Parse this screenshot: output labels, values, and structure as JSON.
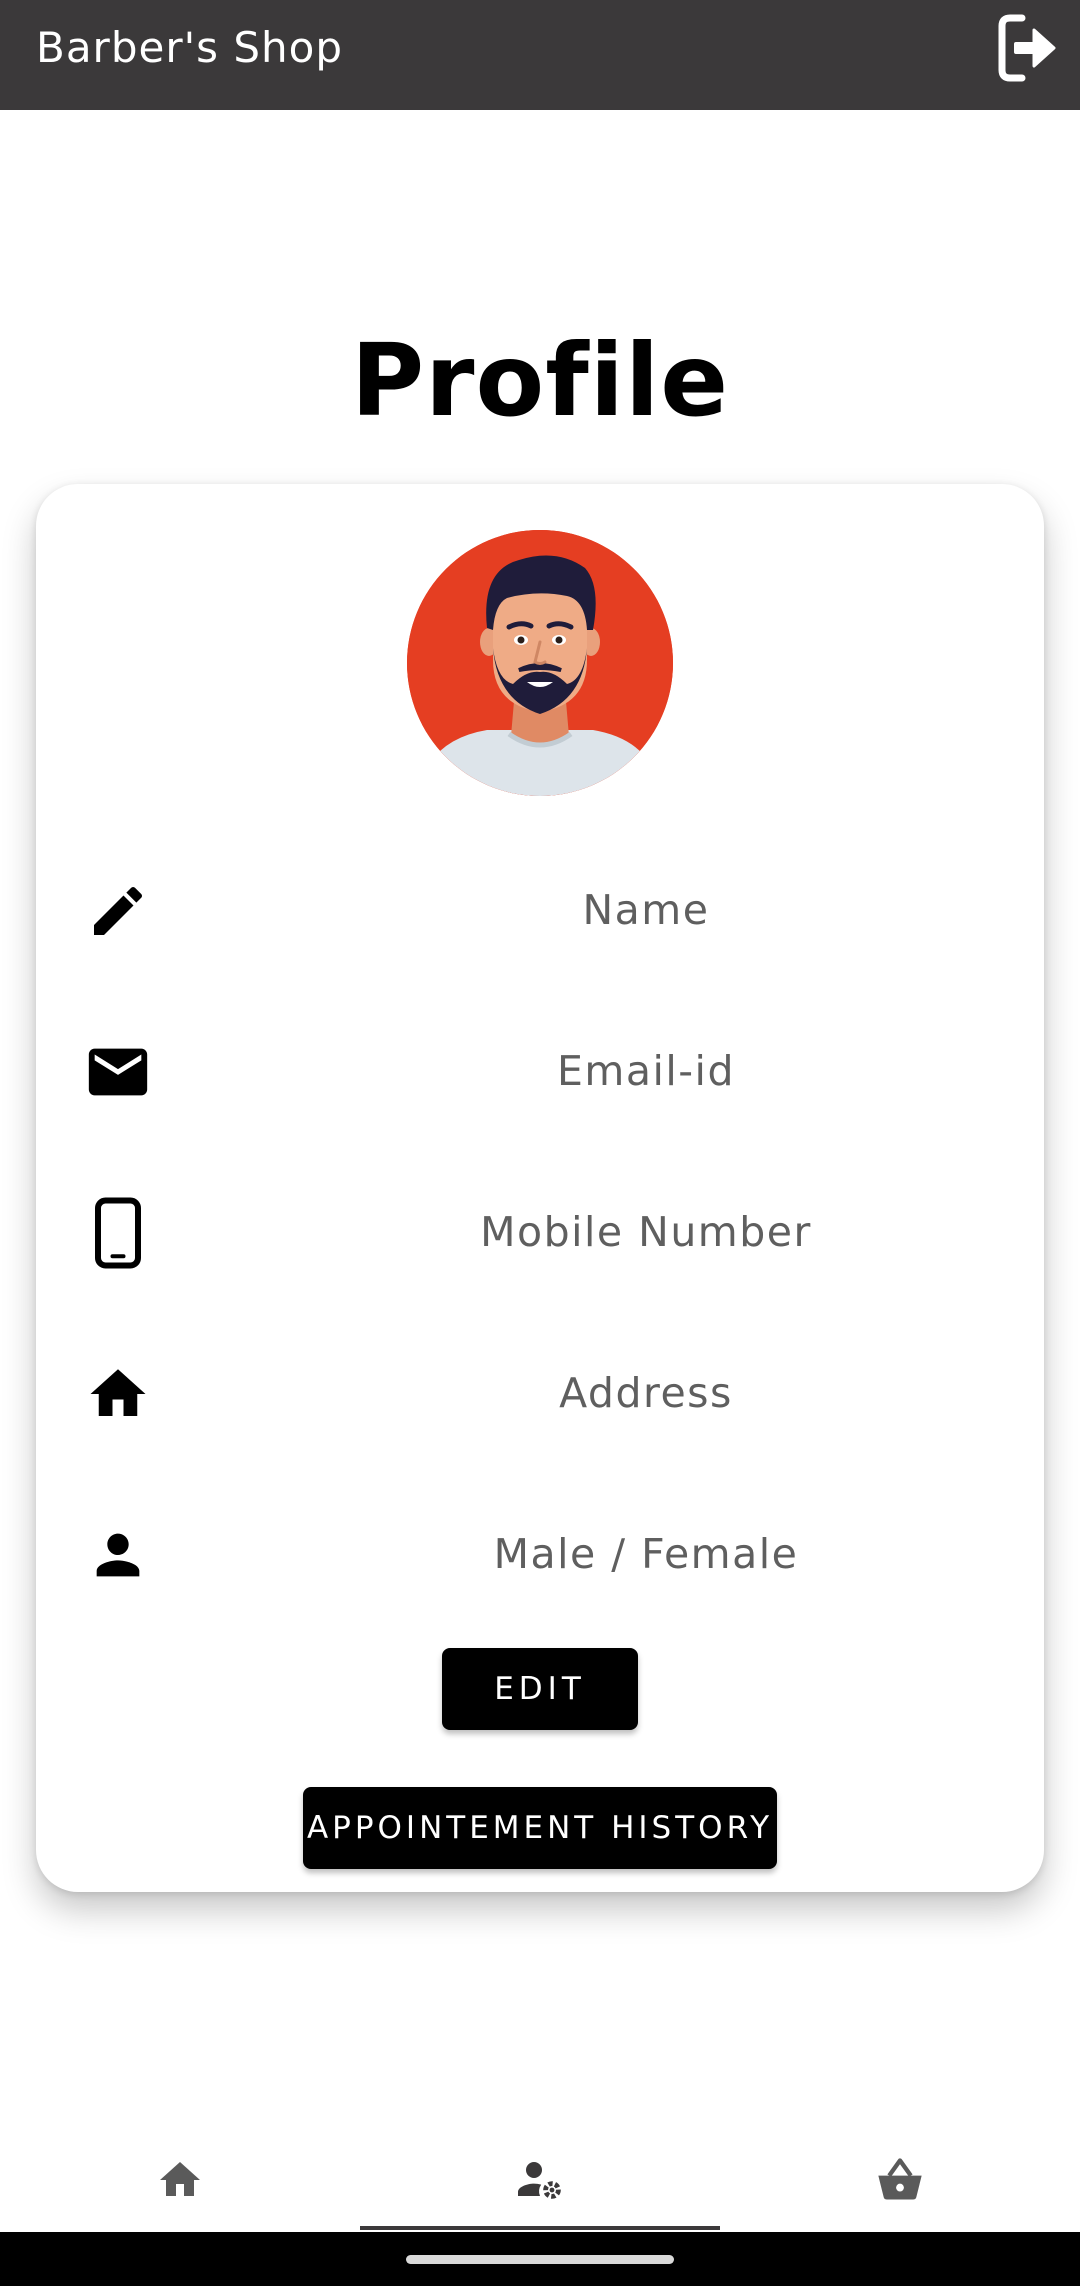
{
  "app_bar": {
    "title": "Barber's Shop",
    "action_icon": "logout-icon"
  },
  "page": {
    "title": "Profile"
  },
  "profile": {
    "avatar_icon": "bearded-man-avatar",
    "fields": [
      {
        "icon": "pencil-icon",
        "text": "Name"
      },
      {
        "icon": "email-icon",
        "text": "Email-id"
      },
      {
        "icon": "phone-icon",
        "text": "Mobile Number"
      },
      {
        "icon": "home-icon",
        "text": "Address"
      },
      {
        "icon": "person-icon",
        "text": "Male / Female"
      }
    ],
    "edit_label": "EDIT",
    "history_label": "APPOINTEMENT HISTORY"
  },
  "bottom_nav": {
    "items": [
      {
        "icon": "home-icon",
        "active": false
      },
      {
        "icon": "user-settings-icon",
        "active": true
      },
      {
        "icon": "basket-icon",
        "active": false
      }
    ]
  },
  "colors": {
    "app_bar": "#3b393a",
    "avatar_bg": "#e53e22",
    "button_bg": "#000000",
    "field_text": "#5f5f5f"
  }
}
